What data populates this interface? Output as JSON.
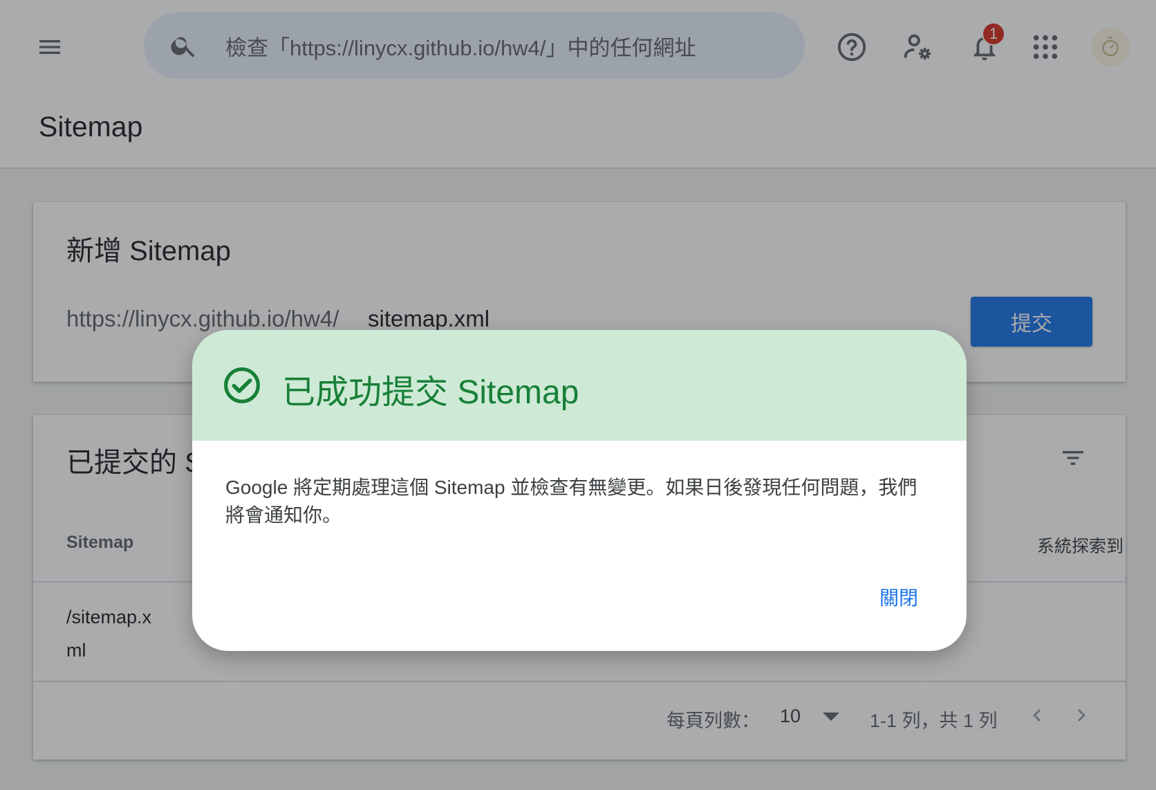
{
  "topbar": {
    "search_placeholder": "檢查「https://linycx.github.io/hw4/」中的任何網址",
    "notification_count": "1"
  },
  "page": {
    "title": "Sitemap"
  },
  "add_card": {
    "title": "新增 Sitemap",
    "url_prefix": "https://linycx.github.io/hw4/",
    "input_value": "sitemap.xml",
    "submit_label": "提交"
  },
  "submitted_card": {
    "title": "已提交的 Sitemap",
    "columns": [
      "Sitemap",
      "系統探索到"
    ],
    "rows": [
      {
        "path": "/sitemap.xml"
      }
    ],
    "pager": {
      "rows_per_page_label": "每頁列數：",
      "rows_per_page_value": "10",
      "range_text": "1-1 列，共 1 列"
    }
  },
  "dialog": {
    "title": "已成功提交 Sitemap",
    "body": "Google 將定期處理這個 Sitemap 並檢查有無變更。如果日後發現任何問題，我們將會通知你。",
    "close_label": "關閉"
  },
  "colors": {
    "accent": "#1a73e8",
    "success": "#188038",
    "success_bg": "#ceead6",
    "badge": "#d93025"
  },
  "icons": [
    "menu-icon",
    "search-icon",
    "help-icon",
    "admin-settings-icon",
    "notifications-icon",
    "apps-icon",
    "check-circle-icon",
    "filter-icon",
    "chevron-left-icon",
    "chevron-right-icon",
    "dropdown-arrow-icon"
  ]
}
